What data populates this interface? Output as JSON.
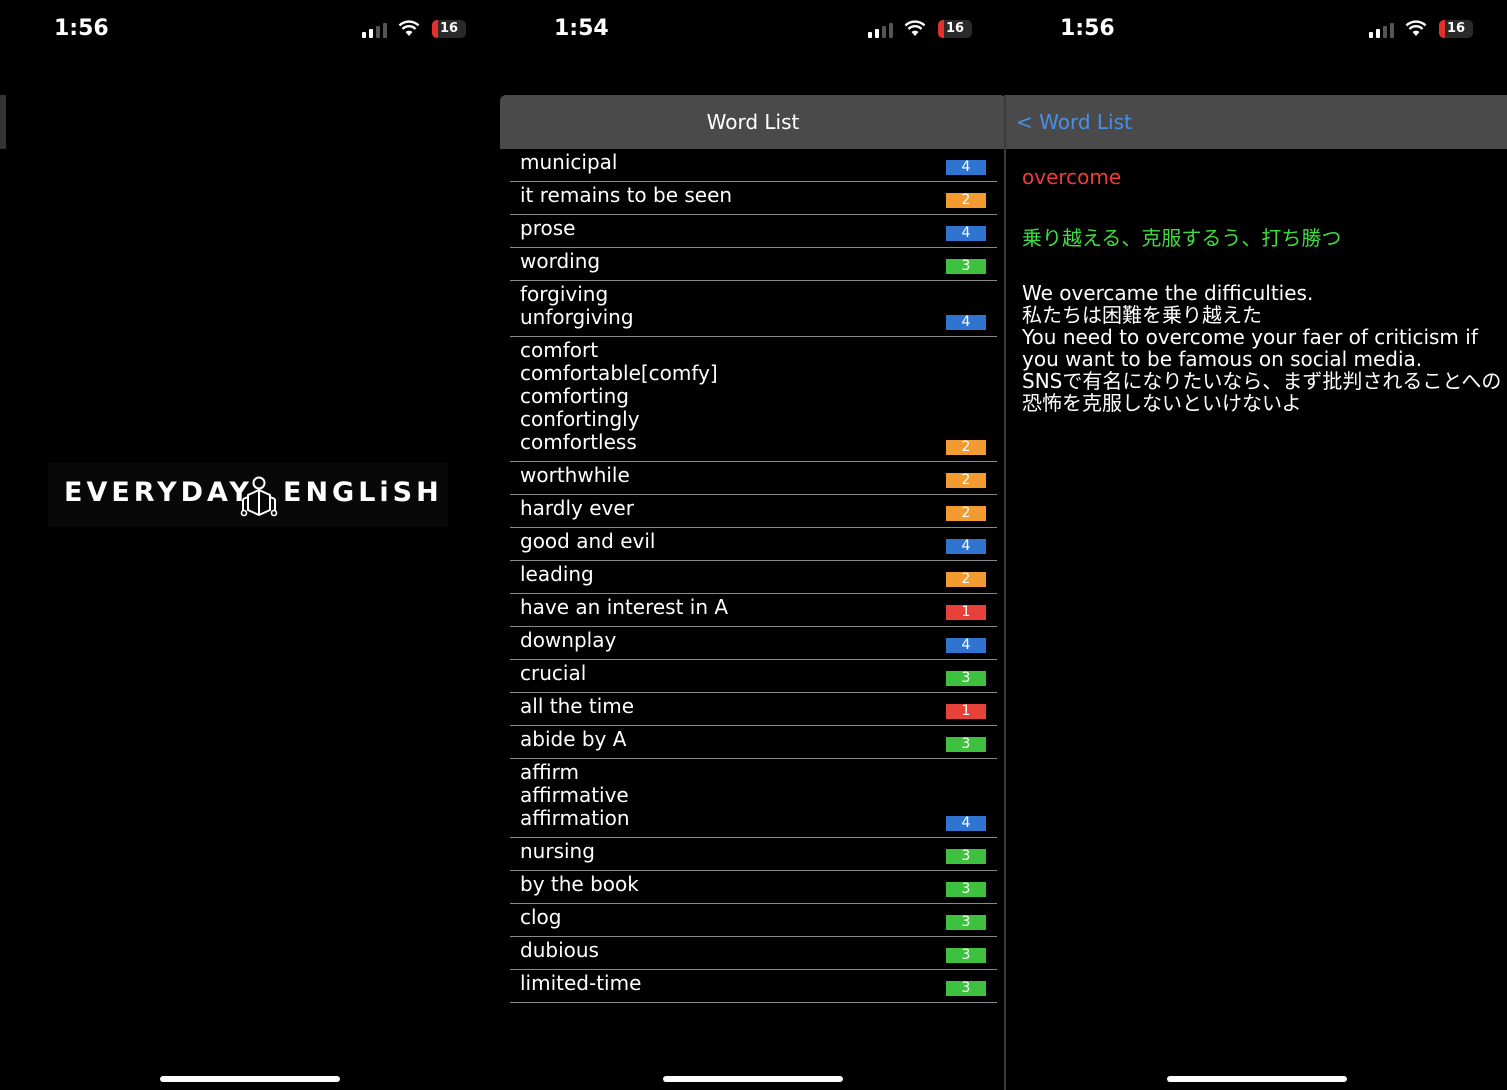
{
  "screens": [
    {
      "time": "1:56",
      "battery": "16"
    },
    {
      "time": "1:54",
      "battery": "16"
    },
    {
      "time": "1:56",
      "battery": "16"
    }
  ],
  "splash": {
    "logo_left": "EVERYDAY",
    "logo_right": "ENGLiSH",
    "logo_icon": "book-reader-icon"
  },
  "word_list": {
    "title": "Word List",
    "level_colors": {
      "1": "#e8413a",
      "2": "#f29b30",
      "3": "#3ec13e",
      "4": "#2f74d0"
    },
    "items": [
      {
        "word": "municipal",
        "level": "4"
      },
      {
        "word": "it remains to be seen",
        "level": "2"
      },
      {
        "word": "prose",
        "level": "4"
      },
      {
        "word": "wording",
        "level": "3"
      },
      {
        "word": "forgiving\nunforgiving",
        "level": "4"
      },
      {
        "word": "comfort\ncomfortable[comfy]\ncomforting\nconfortingly\ncomfortless",
        "level": "2"
      },
      {
        "word": "worthwhile",
        "level": "2"
      },
      {
        "word": "hardly ever",
        "level": "2"
      },
      {
        "word": "good and evil",
        "level": "4"
      },
      {
        "word": "leading",
        "level": "2"
      },
      {
        "word": "have an interest in A",
        "level": "1"
      },
      {
        "word": "downplay",
        "level": "4"
      },
      {
        "word": "crucial",
        "level": "3"
      },
      {
        "word": "all the time",
        "level": "1"
      },
      {
        "word": "abide by A",
        "level": "3"
      },
      {
        "word": "affirm\naffirmative\naffirmation",
        "level": "4"
      },
      {
        "word": "nursing",
        "level": "3"
      },
      {
        "word": "by the book",
        "level": "3"
      },
      {
        "word": "clog",
        "level": "3"
      },
      {
        "word": "dubious",
        "level": "3"
      },
      {
        "word": "limited-time",
        "level": "3"
      }
    ]
  },
  "detail": {
    "back_label": "< Word List",
    "word": "overcome",
    "meaning": "乗り越える、克服するう、打ち勝つ",
    "example": "We overcame the difficulties.\n私たちは困難を乗り越えた\nYou need to overcome your faer of criticism if you want to be famous on social media.\nSNSで有名になりたいなら、まず批判されることへの恐怖を克服しないといけないよ",
    "colors": {
      "word": "#ee3b3b",
      "meaning": "#3fdd3f",
      "back": "#4a8fe6"
    }
  }
}
